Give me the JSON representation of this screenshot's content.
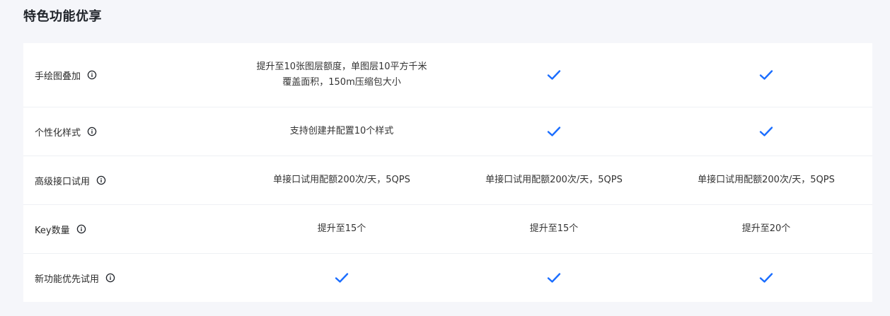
{
  "section": {
    "title": "特色功能优享"
  },
  "rows": [
    {
      "label": "手绘图叠加",
      "values": [
        {
          "type": "text",
          "text": "提升至10张图层额度，单图层10平方千米覆盖面积，150m压缩包大小"
        },
        {
          "type": "check"
        },
        {
          "type": "check"
        }
      ]
    },
    {
      "label": "个性化样式",
      "values": [
        {
          "type": "text",
          "text": "支持创建并配置10个样式"
        },
        {
          "type": "check"
        },
        {
          "type": "check"
        }
      ]
    },
    {
      "label": "高级接口试用",
      "values": [
        {
          "type": "text",
          "text": "单接口试用配额200次/天，5QPS"
        },
        {
          "type": "text",
          "text": "单接口试用配额200次/天，5QPS"
        },
        {
          "type": "text",
          "text": "单接口试用配额200次/天，5QPS"
        }
      ]
    },
    {
      "label": "Key数量",
      "values": [
        {
          "type": "text",
          "text": "提升至15个"
        },
        {
          "type": "text",
          "text": "提升至15个"
        },
        {
          "type": "text",
          "text": "提升至20个"
        }
      ]
    },
    {
      "label": "新功能优先试用",
      "values": [
        {
          "type": "check"
        },
        {
          "type": "check"
        },
        {
          "type": "check"
        }
      ]
    }
  ],
  "icons": {
    "info": "info-icon",
    "check": "check-icon"
  },
  "colors": {
    "accent": "#1a6dff",
    "background": "#f5f6fa",
    "card": "#ffffff",
    "divider": "#eef0f4"
  }
}
